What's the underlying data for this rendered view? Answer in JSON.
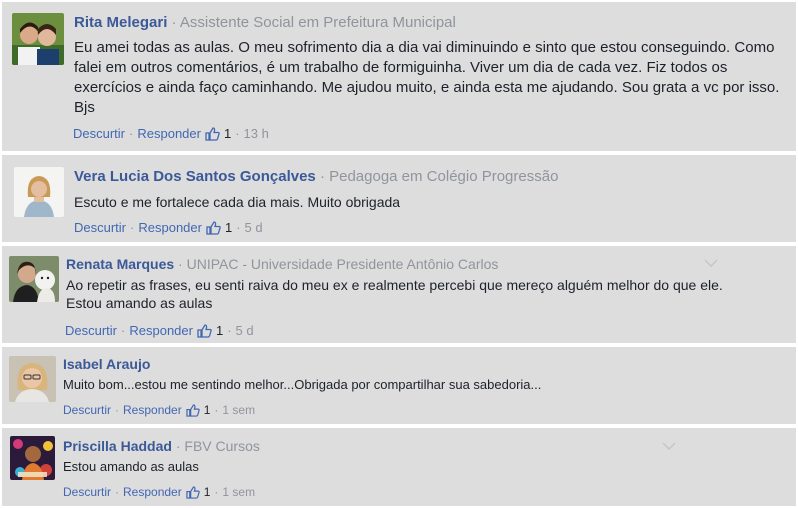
{
  "comments": [
    {
      "name": "Rita Melegari",
      "role": "Assistente Social em Prefeitura Municipal",
      "text": "Eu amei todas as aulas. O meu sofrimento dia a dia vai diminuindo e sinto que estou conseguindo. Como falei em outros comentários, é um trabalho de formiguinha. Viver um dia de cada vez. Fiz todos os exercícios e ainda faço caminhando. Me ajudou muito, e ainda esta me ajudando. Sou grata a vc por isso. Bjs",
      "reply_label": "Descurtir",
      "respond_label": "Responder",
      "likes": "1",
      "time": "13 h"
    },
    {
      "name": "Vera Lucia Dos Santos Gonçalves",
      "role": "Pedagoga em Colégio Progressão",
      "text": "Escuto e me fortalece cada dia mais. Muito obrigada",
      "reply_label": "Descurtir",
      "respond_label": "Responder",
      "likes": "1",
      "time": "5 d"
    },
    {
      "name": "Renata Marques",
      "role": "UNIPAC - Universidade Presidente Antônio Carlos",
      "text": "Ao repetir as frases, eu senti raiva do meu ex e realmente percebi que mereço alguém melhor do que ele. Estou amando as aulas",
      "reply_label": "Descurtir",
      "respond_label": "Responder",
      "likes": "1",
      "time": "5 d"
    },
    {
      "name": "Isabel Araujo",
      "role": "",
      "text": "Muito bom...estou me sentindo melhor...Obrigada por compartilhar sua sabedoria...",
      "reply_label": "Descurtir",
      "respond_label": "Responder",
      "likes": "1",
      "time": "1 sem"
    },
    {
      "name": "Priscilla Haddad",
      "role": "FBV Cursos",
      "text": "Estou amando as aulas",
      "reply_label": "Descurtir",
      "respond_label": "Responder",
      "likes": "1",
      "time": "1 sem"
    }
  ],
  "separator": "·",
  "icons": {
    "like": "thumbs-up-icon",
    "menu": "chevron-down-icon"
  },
  "colors": {
    "name": "#3b5998",
    "link": "#4267b2",
    "meta": "#90949c",
    "card": "#dddddd"
  }
}
